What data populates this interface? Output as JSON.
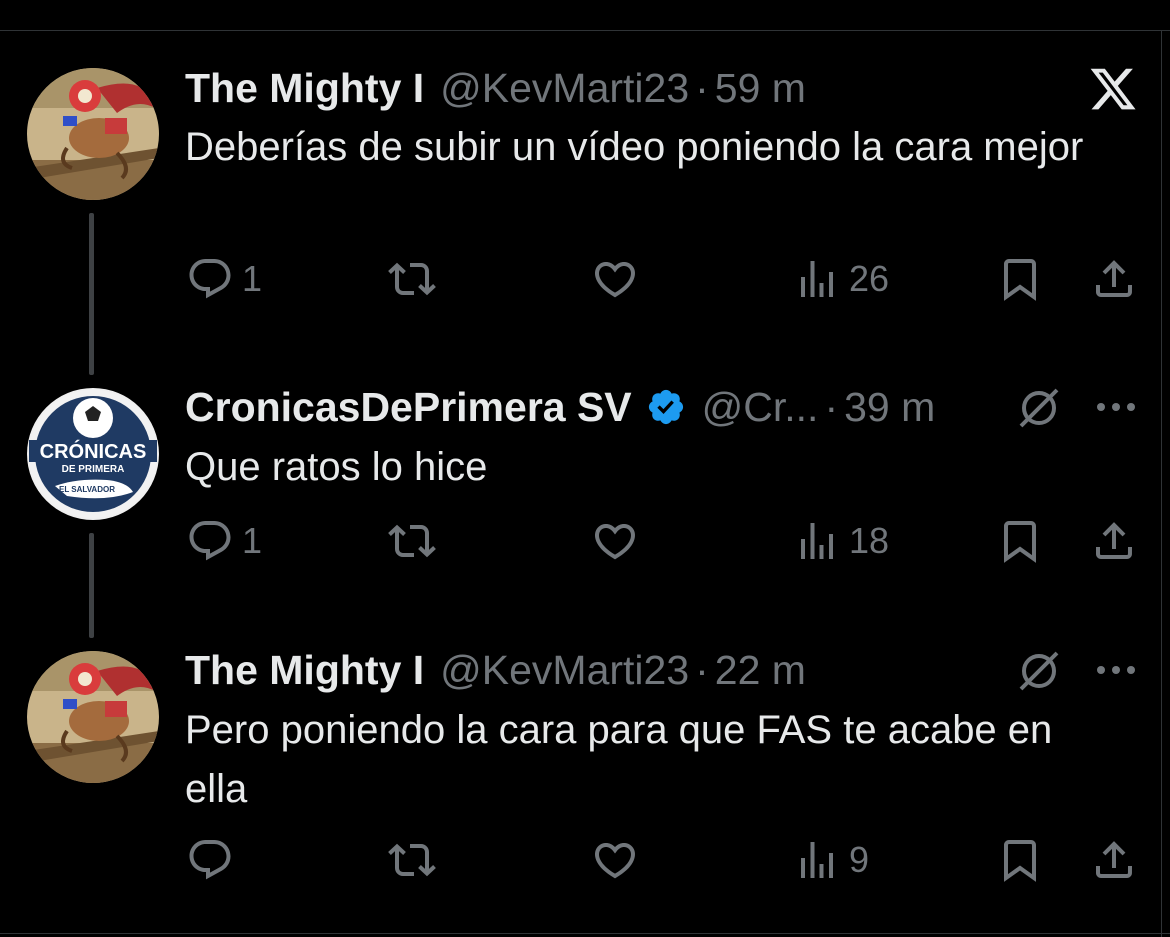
{
  "tweets": [
    {
      "name": "The Mighty I",
      "handle": "@KevMarti23",
      "dot": "·",
      "time": "59 m",
      "text": "Deberías de subir un vídeo poniendo la cara mejor",
      "replies": "1",
      "views": "26"
    },
    {
      "name": "CronicasDePrimera SV",
      "handle": "@Cr...",
      "dot": "·",
      "time": "39 m",
      "text": "Que ratos lo hice",
      "replies": "1",
      "views": "18",
      "avatar_text": {
        "line1": "CRÓNICAS",
        "line2": "DE PRIMERA",
        "line3": "EL SALVADOR"
      }
    },
    {
      "name": "The Mighty I",
      "handle": "@KevMarti23",
      "dot": "·",
      "time": "22 m",
      "text": "Pero poniendo la cara para que FAS te acabe en ella",
      "replies": "",
      "views": "9"
    }
  ],
  "icons": [
    "x-logo-icon",
    "reply-icon",
    "retweet-icon",
    "like-icon",
    "views-icon",
    "bookmark-icon",
    "share-icon",
    "more-icon",
    "grok-icon",
    "verified-badge-icon"
  ],
  "colors": {
    "background": "#000000",
    "text": "#e7e9ea",
    "muted": "#71767b",
    "verified": "#1d9bf0"
  }
}
